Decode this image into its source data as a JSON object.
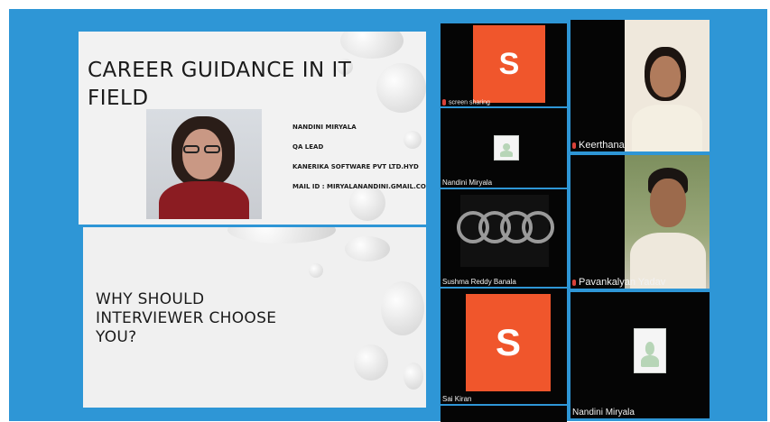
{
  "slides": [
    {
      "title_line1": "CAREER GUIDANCE IN IT",
      "title_line2": "FIELD",
      "presenter_name": "NANDINI MIRYALA",
      "presenter_role": "QA LEAD",
      "presenter_company": "KANERIKA SOFTWARE PVT LTD.HYD",
      "presenter_mail": "MAIL ID : MIRYALANANDINI.GMAIL.COM"
    },
    {
      "title_line1": "WHY SHOULD",
      "title_line2": "INTERVIEWER CHOOSE",
      "title_line3": "YOU?"
    }
  ],
  "participants": {
    "screen_share": {
      "name": "screen sharing",
      "initial": "S"
    },
    "nandini_top": {
      "name": "Nandini Miryala"
    },
    "sushma": {
      "name": "Sushma Reddy Banala"
    },
    "sai": {
      "name": "Sai Kiran",
      "initial": "S"
    },
    "keerthana": {
      "name": "Keerthana"
    },
    "pavankalyan": {
      "name": "Pavankalyan Yadav"
    },
    "nandini_bottom": {
      "name": "Nandini Miryala"
    }
  },
  "colors": {
    "frame_blue": "#2e96d6",
    "avatar_orange": "#f0562c",
    "tile_black": "#050505"
  }
}
